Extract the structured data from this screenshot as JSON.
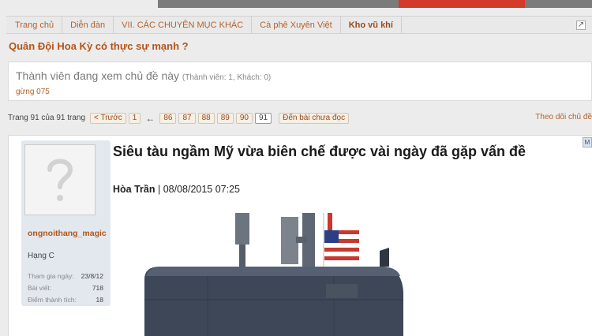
{
  "breadcrumbs": [
    {
      "label": "Trang chủ",
      "current": false
    },
    {
      "label": "Diễn đàn",
      "current": false
    },
    {
      "label": "VII. CÁC CHUYÊN MỤC KHÁC",
      "current": false
    },
    {
      "label": "Cà phê Xuyên Việt",
      "current": false
    },
    {
      "label": "Kho vũ khí",
      "current": true
    }
  ],
  "thread_title": "Quân Đội Hoa Kỳ có thực sự mạnh ?",
  "viewers": {
    "heading": "Thành viên đang xem chủ đề này",
    "counts": "(Thành viên: 1, Khách: 0)",
    "user": "gừng 075"
  },
  "pagination": {
    "label": "Trang 91 của 91 trang",
    "prev": "< Trước",
    "first": "1",
    "arrow": "←",
    "pages": [
      "86",
      "87",
      "88",
      "89",
      "90",
      "91"
    ],
    "current": "91",
    "unread": "Đến bài chưa đọc"
  },
  "follow_label": "Theo dõi chủ đề",
  "post": {
    "author": {
      "username": "ongnoithang_magic",
      "rank": "Hạng C",
      "stats": [
        {
          "label": "Tham gia ngày:",
          "value": "23/8/12"
        },
        {
          "label": "Bài viết:",
          "value": "718"
        },
        {
          "label": "Điểm thành tích:",
          "value": "18"
        }
      ]
    },
    "headline": "Siêu tàu ngầm Mỹ vừa biên chế được vài ngày đã gặp vấn đề",
    "byline_author": "Hòa Trần",
    "byline_date": " | 08/08/2015 07:25",
    "corner_label": "M"
  },
  "colors": {
    "link": "#b5612a",
    "title": "#b4541a",
    "background": "#ececec",
    "hull": "#3d4757"
  },
  "icons": [
    "external-link-icon",
    "avatar-placeholder-icon",
    "arrow-left-icon"
  ]
}
